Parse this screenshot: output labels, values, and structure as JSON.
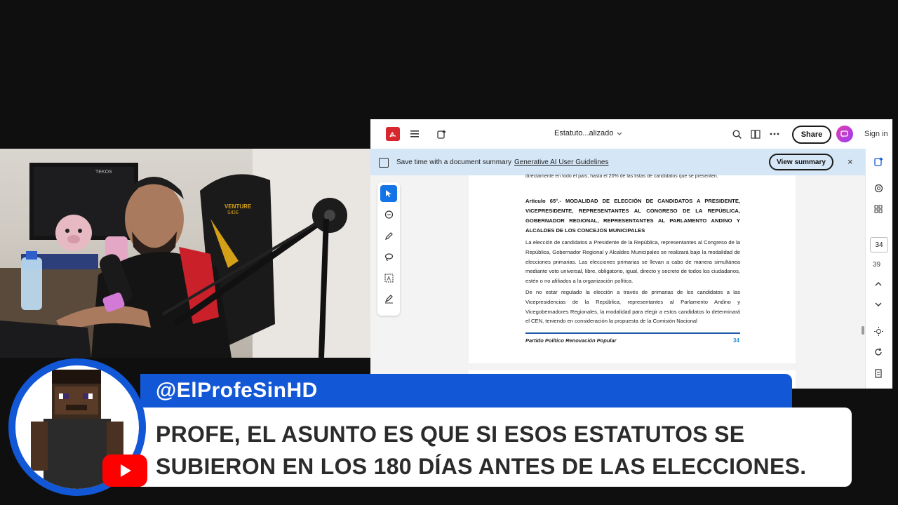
{
  "viewer": {
    "doc_title": "Estatuto...alizado",
    "share_label": "Share",
    "sign_in_label": "Sign in",
    "banner": {
      "text": "Save time with a document summary",
      "link": "Generative AI User Guidelines",
      "button": "View summary",
      "close": "×"
    },
    "page_number": "34",
    "page_total": "39"
  },
  "document": {
    "cut_line": "directamente en todo el país, hasta el 20% de las listas de candidatos que se presenten.",
    "heading": "Artículo 65°.- MODALIDAD DE ELECCIÓN DE CANDIDATOS A PRESIDENTE, VICEPRESIDENTE, REPRESENTANTES AL CONGRESO DE LA REPÚBLICA, GOBERNADOR REGIONAL, REPRESENTANTES AL PARLAMENTO ANDINO Y ALCALDES DE LOS CONCEJOS MUNICIPALES",
    "paragraph1": "La elección de candidatos a Presidente de la República, representantes al Congreso de la República, Gobernador Regional y Alcaldes Municipales se realizará bajo la modalidad de elecciones primarias. Las elecciones primarias se llevan a cabo de manera simultánea mediante voto universal, libre, obligatorio, igual, directo y secreto de todos los ciudadanos, estén o no afiliados a la organización política.",
    "paragraph2": "De no estar regulado la elección a través de primarias de los candidatos a las Vicepresidencias de la República, representantes al Parlamento Andino y Vicegobernadores Regionales, la modalidad para elegir a estos candidatos lo determinará el CEN, teniendo en consideración la propuesta de la Comisión Nacional",
    "footer": "Partido Político Renovación Popular",
    "footer_page": "34"
  },
  "chat": {
    "username": "@ElProfeSinHD",
    "message": "PROFE, EL ASUNTO ES QUE SI ESOS ESTATUTOS SE SUBIERON EN LOS 180 DÍAS ANTES DE LAS ELECCIONES."
  },
  "webcam": {
    "chair_brand": "VENTURE",
    "chair_sub": "SIDE",
    "monitor_brand": "TEKOS"
  },
  "icons": [
    "pdf-logo-icon",
    "menu-icon",
    "ai-assistant-icon",
    "chevron-down-icon",
    "search-icon",
    "pages-icon",
    "more-icon",
    "chat-icon",
    "select-icon",
    "comment-icon",
    "draw-icon",
    "lasso-icon",
    "text-box-icon",
    "sign-icon",
    "close-icon",
    "chevron-up-icon",
    "refresh-icon",
    "youtube-icon"
  ],
  "colors": {
    "accent": "#1257d6",
    "pdf_red": "#d7262d",
    "banner": "#d5e6f7",
    "link_blue": "#1f8fd6"
  }
}
